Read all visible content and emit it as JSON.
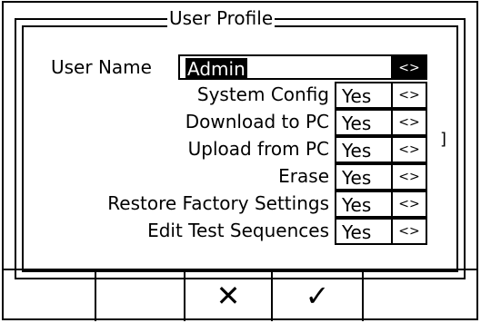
{
  "dialog": {
    "title": "User Profile"
  },
  "user_name": {
    "label": "User Name",
    "value": "Admin",
    "toggle": "<>"
  },
  "permissions": [
    {
      "label": "System Config",
      "value": "Yes",
      "toggle": "<>"
    },
    {
      "label": "Download to PC",
      "value": "Yes",
      "toggle": "<>"
    },
    {
      "label": "Upload from PC",
      "value": "Yes",
      "toggle": "<>"
    },
    {
      "label": "Erase",
      "value": "Yes",
      "toggle": "<>"
    },
    {
      "label": "Restore Factory Settings",
      "value": "Yes",
      "toggle": "<>"
    },
    {
      "label": "Edit Test Sequences",
      "value": "Yes",
      "toggle": "<>"
    }
  ],
  "stray_glyph": "]",
  "softkeys": {
    "cancel": "✕",
    "confirm": "✓"
  }
}
